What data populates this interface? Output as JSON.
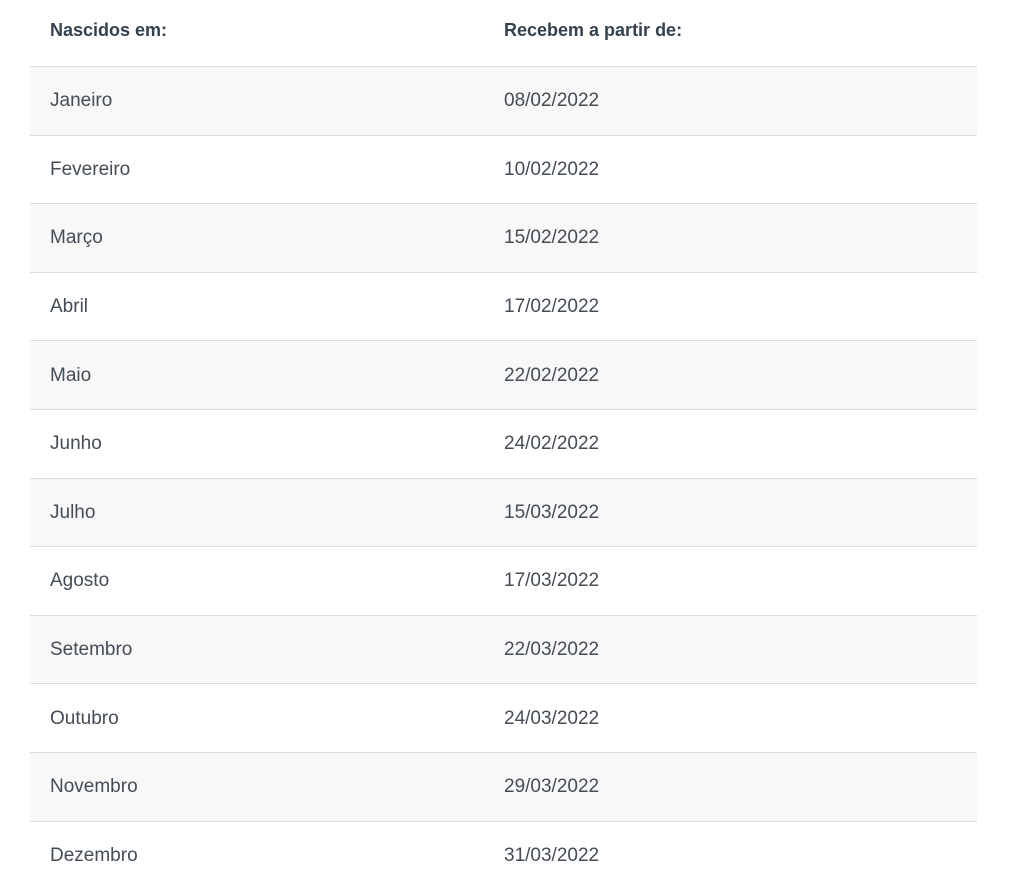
{
  "table": {
    "headers": [
      "Nascidos em:",
      "Recebem a partir de:"
    ],
    "rows": [
      [
        "Janeiro",
        "08/02/2022"
      ],
      [
        "Fevereiro",
        "10/02/2022"
      ],
      [
        "Março",
        "15/02/2022"
      ],
      [
        "Abril",
        "17/02/2022"
      ],
      [
        "Maio",
        "22/02/2022"
      ],
      [
        "Junho",
        "24/02/2022"
      ],
      [
        "Julho",
        "15/03/2022"
      ],
      [
        "Agosto",
        "17/03/2022"
      ],
      [
        "Setembro",
        "22/03/2022"
      ],
      [
        "Outubro",
        "24/03/2022"
      ],
      [
        "Novembro",
        "29/03/2022"
      ],
      [
        "Dezembro",
        "31/03/2022"
      ]
    ]
  }
}
